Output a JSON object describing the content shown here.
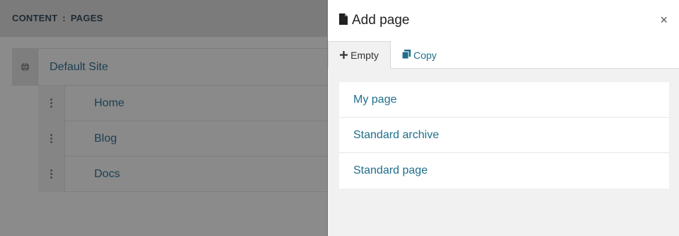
{
  "background": {
    "breadcrumb": {
      "section": "CONTENT",
      "separator": ":",
      "page": "PAGES"
    },
    "site": {
      "label": "Default Site",
      "icon": "globe-icon"
    },
    "pages": [
      {
        "label": "Home"
      },
      {
        "label": "Blog"
      },
      {
        "label": "Docs"
      }
    ]
  },
  "panel": {
    "title": "Add page",
    "title_icon": "file-icon",
    "close_label": "×",
    "tabs": [
      {
        "label": "Empty",
        "icon": "plus-icon",
        "active": true
      },
      {
        "label": "Copy",
        "icon": "copy-icon",
        "active": false
      }
    ],
    "items": [
      {
        "label": "My page"
      },
      {
        "label": "Standard archive"
      },
      {
        "label": "Standard page"
      }
    ]
  },
  "colors": {
    "link": "#1f6f8b",
    "overlay": "#8a8a8a"
  }
}
